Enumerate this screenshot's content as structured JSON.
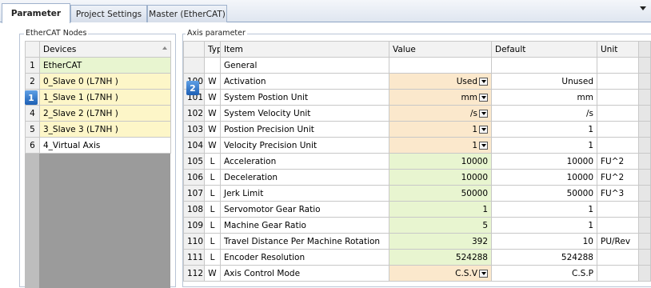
{
  "tabs": [
    {
      "label": "Parameter",
      "active": true
    },
    {
      "label": "Project Settings",
      "active": false
    },
    {
      "label": "Master (EtherCAT)",
      "active": false
    }
  ],
  "nodes_panel": {
    "title": "EtherCAT Nodes",
    "header": "Devices",
    "rows": [
      {
        "num": "1",
        "name": "EtherCAT"
      },
      {
        "num": "2",
        "name": "0_Slave 0 (L7NH )"
      },
      {
        "num": "3",
        "name": "1_Slave 1 (L7NH )"
      },
      {
        "num": "4",
        "name": "2_Slave 2 (L7NH )"
      },
      {
        "num": "5",
        "name": "3_Slave 3 (L7NH )"
      },
      {
        "num": "6",
        "name": "4_Virtual Axis"
      }
    ],
    "badge": "1"
  },
  "axis_panel": {
    "title": "Axis parameter",
    "headers": {
      "type": "Type",
      "item": "Item",
      "value": "Value",
      "default": "Default",
      "unit": "Unit"
    },
    "badge": "2",
    "rows": [
      {
        "num": "",
        "type": "",
        "item": "General",
        "value": "",
        "default": "",
        "unit": ""
      },
      {
        "num": "100",
        "type": "W",
        "item": "Activation",
        "value": "Used",
        "default": "Unused",
        "unit": ""
      },
      {
        "num": "101",
        "type": "W",
        "item": "System Postion Unit",
        "value": "mm",
        "default": "mm",
        "unit": ""
      },
      {
        "num": "102",
        "type": "W",
        "item": "System Velocity Unit",
        "value": "/s",
        "default": "/s",
        "unit": ""
      },
      {
        "num": "103",
        "type": "W",
        "item": "Postion Precision Unit",
        "value": "1",
        "default": "1",
        "unit": ""
      },
      {
        "num": "104",
        "type": "W",
        "item": "Velocity Precision Unit",
        "value": "1",
        "default": "1",
        "unit": ""
      },
      {
        "num": "105",
        "type": "L",
        "item": "Acceleration",
        "value": "10000",
        "default": "10000",
        "unit": "FU^2"
      },
      {
        "num": "106",
        "type": "L",
        "item": "Deceleration",
        "value": "10000",
        "default": "10000",
        "unit": "FU^2"
      },
      {
        "num": "107",
        "type": "L",
        "item": "Jerk Limit",
        "value": "50000",
        "default": "50000",
        "unit": "FU^3"
      },
      {
        "num": "108",
        "type": "L",
        "item": "Servomotor Gear Ratio",
        "value": "1",
        "default": "1",
        "unit": ""
      },
      {
        "num": "109",
        "type": "L",
        "item": "Machine Gear Ratio",
        "value": "5",
        "default": "1",
        "unit": ""
      },
      {
        "num": "110",
        "type": "L",
        "item": "Travel Distance Per Machine Rotation",
        "value": "392",
        "default": "10",
        "unit": "PU/Rev"
      },
      {
        "num": "111",
        "type": "L",
        "item": "Encoder Resolution",
        "value": "524288",
        "default": "524288",
        "unit": ""
      },
      {
        "num": "112",
        "type": "W",
        "item": "Axis Control Mode",
        "value": "C.S.V",
        "default": "C.S.P",
        "unit": ""
      }
    ]
  }
}
